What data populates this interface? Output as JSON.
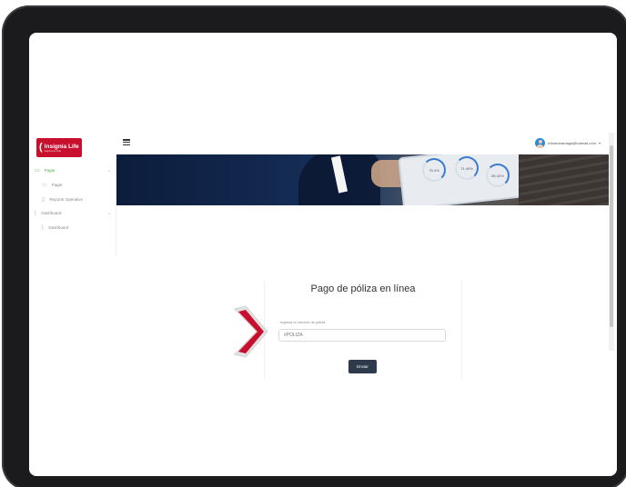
{
  "brand": {
    "logo_mark": "(",
    "logo_name": "Insignia Life",
    "logo_tagline": "Seguros de vida"
  },
  "header": {
    "user_email": "eduardoarriaga@hotmail.com",
    "user_menu_caret": "▾"
  },
  "sidebar": {
    "items": [
      {
        "label": "Pagar",
        "icon": "folder-icon",
        "active": true,
        "expandable": true
      },
      {
        "label": "Pagar",
        "icon": "card-icon",
        "active": false,
        "sub": true
      },
      {
        "label": "Reporte Operativo",
        "icon": "document-icon",
        "active": false,
        "sub": true
      },
      {
        "label": "Dashboard",
        "icon": "chart-icon",
        "active": false,
        "expandable": true
      },
      {
        "label": "Dashboard",
        "icon": "chart-icon",
        "active": false,
        "sub": true
      }
    ]
  },
  "banner": {
    "dials": [
      "75.4%",
      "71.40%",
      "55.42%"
    ]
  },
  "form": {
    "title": "Pago de póliza en línea",
    "field_label": "Ingresa el número de póliza",
    "field_placeholder": "#PÓLIZA",
    "field_value": "",
    "submit_label": "Enviar"
  },
  "colors": {
    "brand_red": "#c8102e",
    "button_dark": "#2e3a4b",
    "active_green": "#4caf50",
    "arrow_red": "#c8102e"
  }
}
